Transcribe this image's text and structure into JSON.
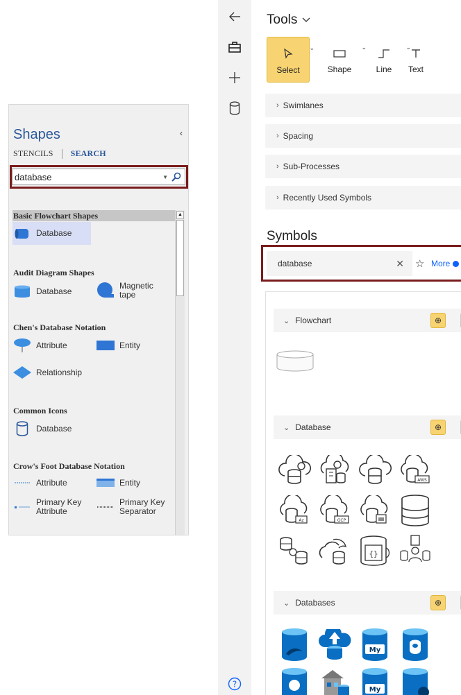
{
  "shapes_panel": {
    "title": "Shapes",
    "tabs": [
      "STENCILS",
      "SEARCH"
    ],
    "search_value": "database",
    "stencils": [
      {
        "name": "Basic Flowchart Shapes",
        "items": [
          "Database"
        ]
      },
      {
        "name": "Audit Diagram Shapes",
        "items": [
          "Database",
          "Magnetic tape"
        ]
      },
      {
        "name": "Chen's Database Notation",
        "items": [
          "Attribute",
          "Entity",
          "Relationship"
        ]
      },
      {
        "name": "Common Icons",
        "items": [
          "Database"
        ]
      },
      {
        "name": "Crow's Foot Database Notation",
        "items": [
          "Attribute",
          "Entity",
          "Primary Key Attribute",
          "Primary Key Separator"
        ]
      }
    ]
  },
  "tools": {
    "title": "Tools",
    "items": [
      "Select",
      "Shape",
      "Line",
      "Text"
    ],
    "sections": [
      "Swimlanes",
      "Spacing",
      "Sub-Processes",
      "Recently Used Symbols"
    ]
  },
  "symbols": {
    "title": "Symbols",
    "search_value": "database",
    "more_label": "More",
    "groups": [
      "Flowchart",
      "Database",
      "Databases"
    ]
  },
  "colors": {
    "accent_yellow": "#f7d372",
    "highlight_box": "#7a1c1c",
    "visio_blue": "#2b579a",
    "azure_blue": "#0a6fc2",
    "link_blue": "#0f62fe"
  }
}
